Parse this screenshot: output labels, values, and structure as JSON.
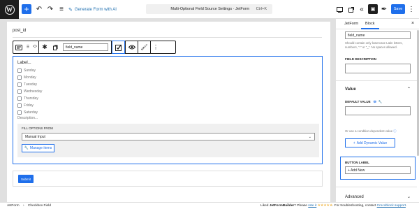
{
  "topbar": {
    "add_label": "+",
    "undo_icon": "↶",
    "redo_icon": "↷",
    "list_icon": "≡",
    "generate_ai": "Generate Form with AI",
    "doc_title": "Multi-Optional Field Source Settings · JetForm",
    "shortcut": "Ctrl+K",
    "save": "Save"
  },
  "editor": {
    "post_id": "post_id",
    "toolbar": {
      "field_name": "field_name"
    },
    "block": {
      "label": "Label...",
      "options": [
        "Sunday",
        "Monday",
        "Tuesday",
        "Wednesday",
        "Thursday",
        "Friday",
        "Saturday"
      ],
      "description": "Description...",
      "fill_title": "FILL OPTIONS FROM",
      "fill_value": "Manual Input",
      "manage_items": "Manage items"
    },
    "submit": "Submit"
  },
  "sidebar": {
    "tabs": [
      "JetForm",
      "Block"
    ],
    "field_name_value": "field_name",
    "field_name_help": "Should contain only lowercase Latin letters, numbers, \"-\" or \"_\". No spaces allowed.",
    "field_description": "FIELD DESCRIPTION",
    "value_heading": "Value",
    "default_value": "DEFAULT VALUE",
    "condition_text": "Or use a condition-dependent value",
    "add_dynamic": "Add Dynamic Value",
    "button_label_cap": "BUTTON LABEL",
    "button_label_value": "+ Add New",
    "advanced": "Advanced"
  },
  "statusbar": {
    "crumb_root": "JetForm",
    "crumb_sep": "›",
    "crumb_current": "Checkbox Field",
    "liked_prefix": "Liked ",
    "liked_brand": "JetFormBuilder",
    "liked_mid": "? Please ",
    "rate_link": "rate it",
    "stars": "★★★★★",
    "support_text": ". For troubleshooting, contact ",
    "support_link": "Crocoblock support"
  },
  "colors": {
    "accent": "#1f6feb",
    "dark": "#1e1e1e"
  }
}
